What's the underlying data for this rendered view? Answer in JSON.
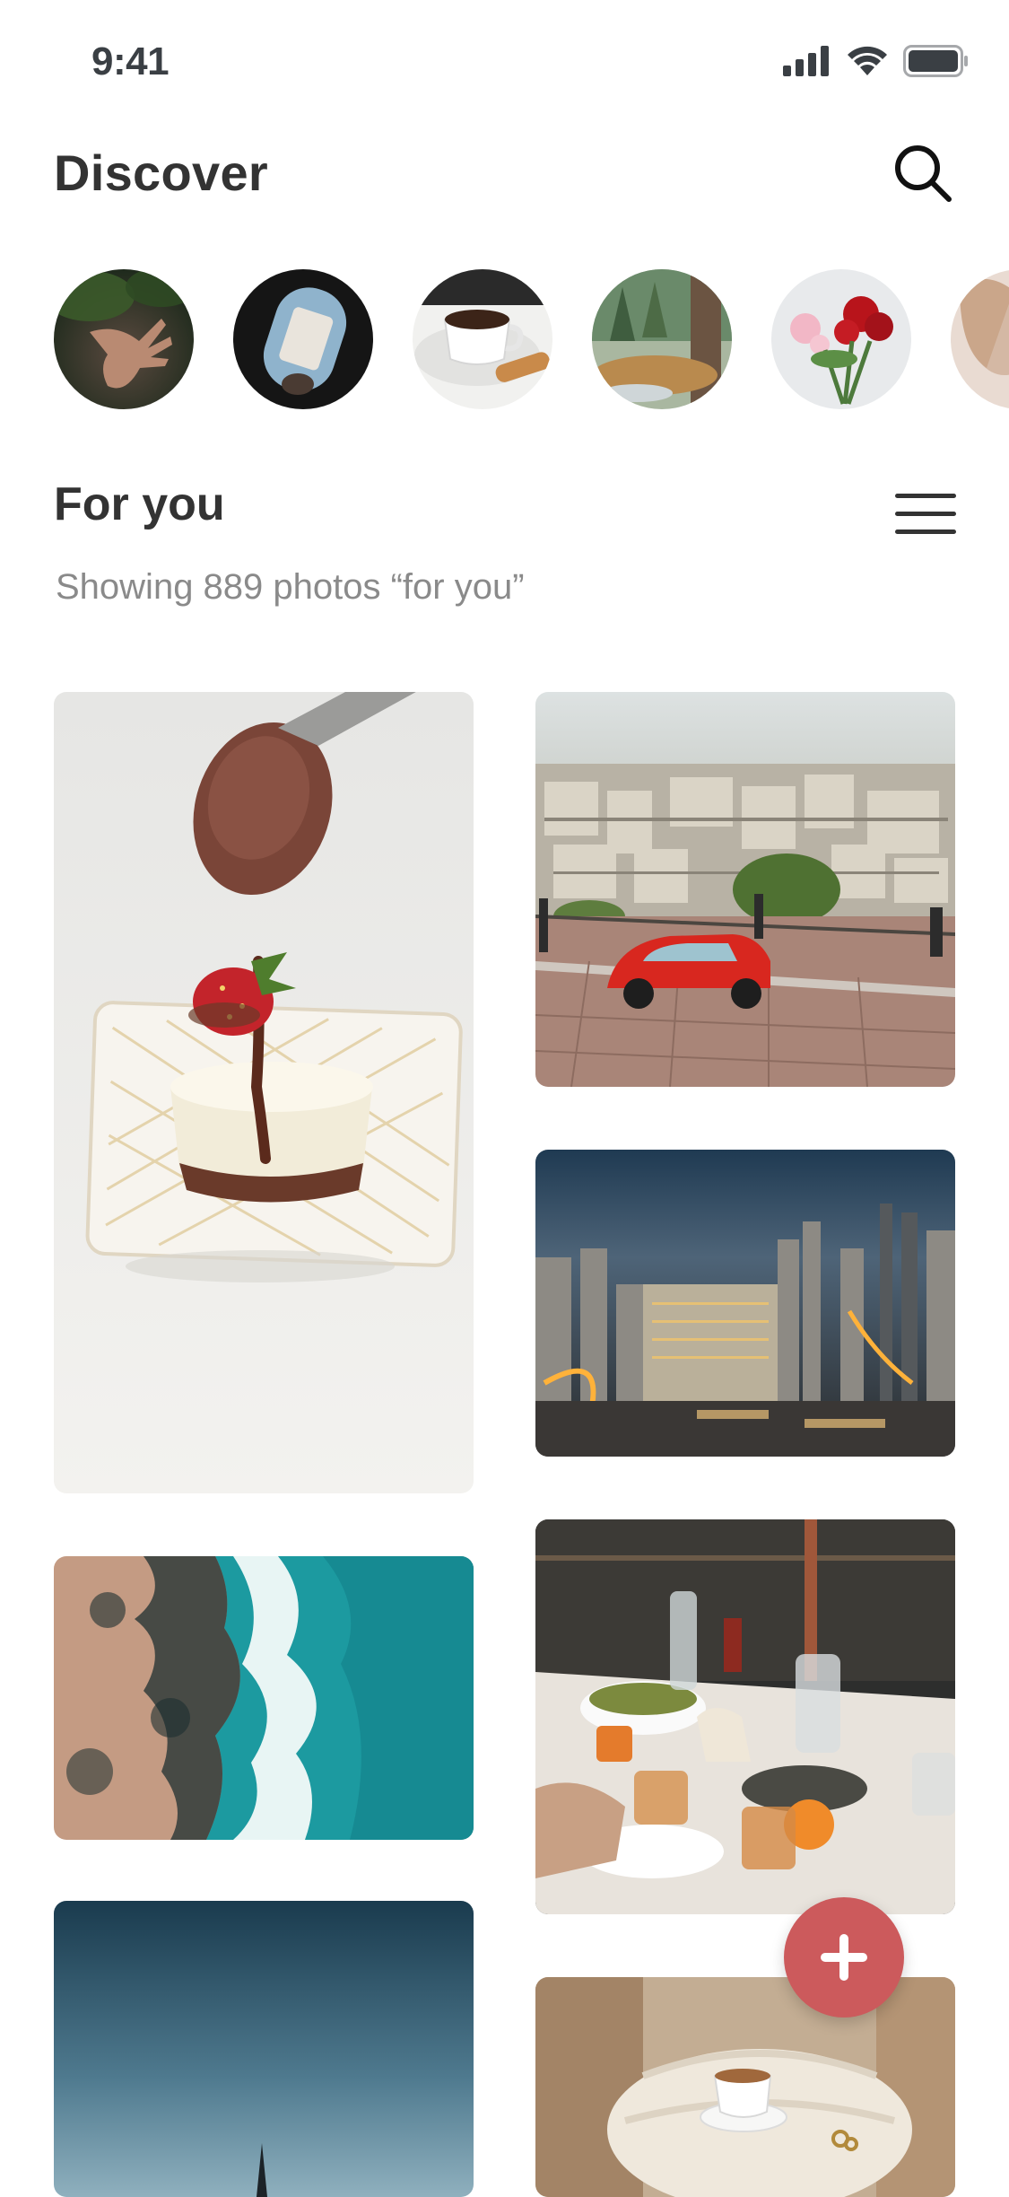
{
  "status_bar": {
    "time": "9:41"
  },
  "header": {
    "title": "Discover",
    "search_icon": "search-icon"
  },
  "stories": [
    {
      "subject": "hand-leaves"
    },
    {
      "subject": "airplane-window"
    },
    {
      "subject": "coffee-cup"
    },
    {
      "subject": "forest-stream"
    },
    {
      "subject": "roses"
    },
    {
      "subject": "portrait"
    }
  ],
  "section": {
    "title": "For you",
    "subtitle": "Showing 889 photos “for you”",
    "menu_icon": "hamburger-menu-icon"
  },
  "photos": [
    {
      "subject": "chocolate-cheesecake"
    },
    {
      "subject": "red-car-city-view"
    },
    {
      "subject": "city-skyline-night"
    },
    {
      "subject": "ocean-shore-aerial"
    },
    {
      "subject": "dinner-table"
    },
    {
      "subject": "blue-sky-spire"
    },
    {
      "subject": "coffee-on-sweater"
    }
  ],
  "fab": {
    "icon": "plus-icon"
  },
  "colors": {
    "accent": "#cc5a5c",
    "text": "#333333",
    "muted": "#8a8a8a"
  }
}
